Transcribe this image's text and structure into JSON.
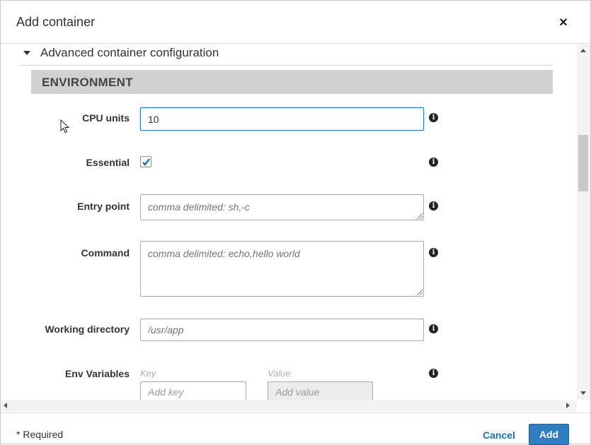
{
  "dialog": {
    "title": "Add container",
    "close_label": "×"
  },
  "section": {
    "toggle_label": "Advanced container configuration",
    "environment_title": "ENVIRONMENT"
  },
  "fields": {
    "cpu_units": {
      "label": "CPU units",
      "value": "10"
    },
    "essential": {
      "label": "Essential",
      "checked": true
    },
    "entry_point": {
      "label": "Entry point",
      "placeholder": "comma delimited: sh,-c"
    },
    "command": {
      "label": "Command",
      "placeholder": "comma delimited: echo,hello world"
    },
    "working_directory": {
      "label": "Working directory",
      "placeholder": "/usr/app"
    },
    "env_variables": {
      "label": "Env Variables",
      "key_header": "Key",
      "value_header": "Value",
      "key_placeholder": "Add key",
      "value_placeholder": "Add value"
    }
  },
  "info_icon_glyph": "i",
  "footer": {
    "required_note": "* Required",
    "cancel_label": "Cancel",
    "add_label": "Add"
  },
  "colors": {
    "primary_button": "#2f7dc2",
    "link": "#1f6fb5",
    "focus_border": "#2b80c5",
    "section_band": "#d1d1d1"
  }
}
